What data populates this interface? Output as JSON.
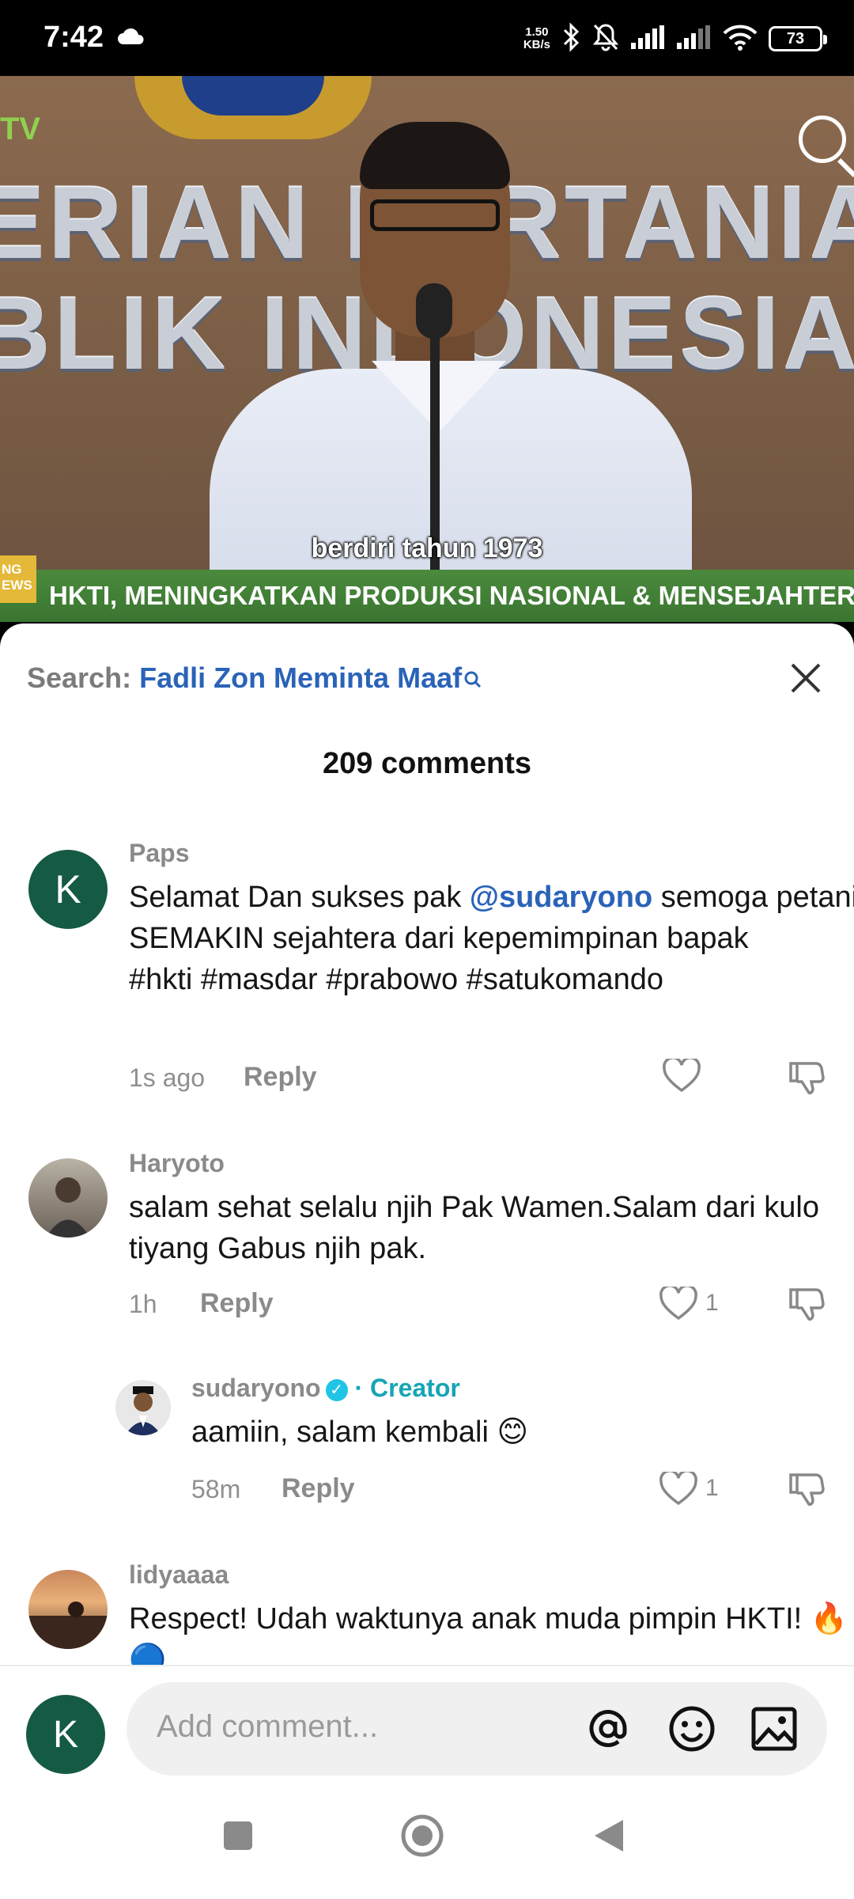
{
  "status_bar": {
    "time": "7:42",
    "net_speed_value": "1.50",
    "net_speed_unit": "KB/s",
    "battery": "73"
  },
  "video": {
    "wall_line1": "ERIAN PERTANIA",
    "wall_line2": "BLIK INDONESIA",
    "tv_logo": "TV",
    "subtitle": "berdiri tahun 1973",
    "ticker_tag_line1": "NG",
    "ticker_tag_line2": "EWS",
    "ticker": "HKTI, MENINGKATKAN PRODUKSI NASIONAL & MENSEJAHTERAKAN PET"
  },
  "sheet": {
    "search_prefix": "Search: ",
    "search_query": "Fadli Zon Meminta Maaf",
    "comment_count": "209 comments"
  },
  "comments": [
    {
      "avatar_letter": "K",
      "username": "Paps",
      "text_before": "Selamat Dan sukses pak ",
      "mention": "@sudaryono",
      "text_after": " semoga petani SEMAKIN sejahtera dari kepemimpinan bapak",
      "hashtags": "#hkti #masdar #prabowo #satukomando",
      "time": "1s ago",
      "reply": "Reply",
      "likes": ""
    },
    {
      "username": "Haryoto",
      "text": "salam sehat selalu njih Pak Wamen.Salam dari kulo tiyang Gabus njih pak.",
      "time": "1h",
      "reply": "Reply",
      "likes": "1"
    },
    {
      "username": "sudaryono",
      "creator_label": "Creator",
      "separator": "·",
      "text": "aamiin, salam kembali 😊",
      "time": "58m",
      "reply": "Reply",
      "likes": "1"
    },
    {
      "username": "lidyaaaa",
      "text": "Respect! Udah waktunya anak muda pimpin HKTI! 🔥🔵"
    }
  ],
  "composer": {
    "avatar_letter": "K",
    "placeholder": "Add comment..."
  },
  "icons": [
    "cloud-icon",
    "bluetooth-icon",
    "mute-icon",
    "signal-icon",
    "wifi-icon",
    "search-icon",
    "close-icon",
    "heart-icon",
    "dislike-icon",
    "at-icon",
    "emoji-icon",
    "image-icon",
    "nav-recents-icon",
    "nav-home-icon",
    "nav-back-icon"
  ],
  "colors": {
    "link_blue": "#2a63b8",
    "creator_teal": "#17a5b5",
    "avatar_green": "#145a44",
    "ticker_green": "#3a7530"
  }
}
